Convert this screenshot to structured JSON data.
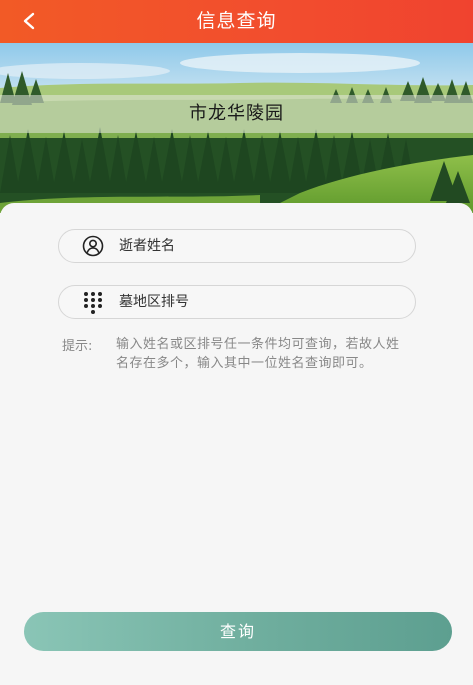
{
  "header": {
    "title": "信息查询",
    "back_icon": "chevron-left-icon",
    "background_color": "#f24d2e"
  },
  "banner": {
    "cemetery_name": "市龙华陵园"
  },
  "form": {
    "name_field": {
      "placeholder": "逝者姓名",
      "value": "",
      "icon": "user-circle-icon"
    },
    "plot_field": {
      "placeholder": "墓地区排号",
      "value": "",
      "icon": "keypad-icon"
    }
  },
  "hint": {
    "label": "提示:",
    "text": "输入姓名或区排号任一条件均可查询，若故人姓名存在多个，输入其中一位姓名查询即可。"
  },
  "actions": {
    "query_label": "查询",
    "query_color": "#6fae9e"
  }
}
